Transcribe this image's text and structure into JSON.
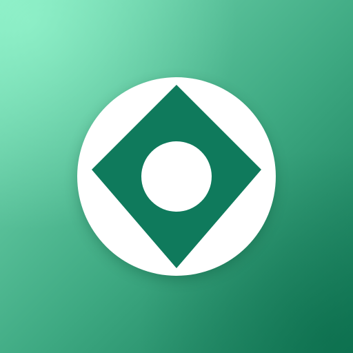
{
  "app_icon": {
    "icon_name": "diamond-with-circle-icon",
    "colors": {
      "background_light": "#7fe3bb",
      "background_dark": "#127a57",
      "badge": "#ffffff",
      "diamond": "#0f7a5c",
      "center_dot": "#ffffff"
    }
  }
}
